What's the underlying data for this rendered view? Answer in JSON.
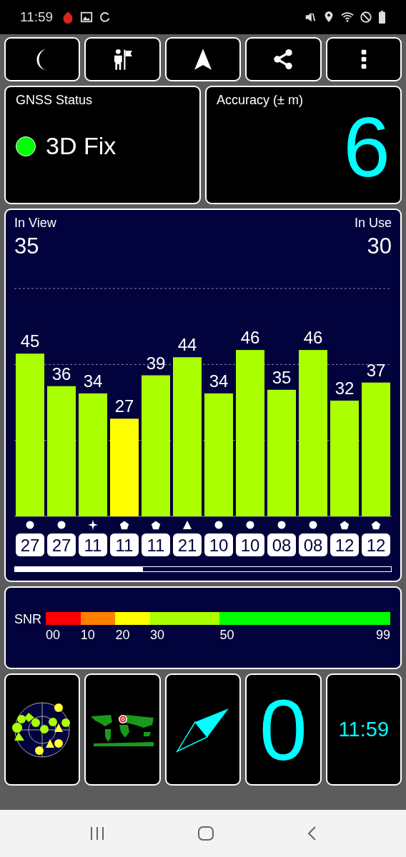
{
  "status_bar": {
    "time": "11:59",
    "left_icons": [
      {
        "kind": "app"
      },
      {
        "kind": "image"
      },
      {
        "kind": "sync"
      }
    ],
    "right_icons": [
      {
        "kind": "mute"
      },
      {
        "kind": "location"
      },
      {
        "kind": "wifi"
      },
      {
        "kind": "block"
      },
      {
        "kind": "battery"
      }
    ]
  },
  "toolbar": [
    {
      "kind": "moon"
    },
    {
      "kind": "person-flag"
    },
    {
      "kind": "navigation"
    },
    {
      "kind": "share"
    },
    {
      "kind": "more"
    }
  ],
  "gnss_status": {
    "title": "GNSS Status",
    "value": "3D Fix",
    "color": "#00ff00"
  },
  "accuracy": {
    "title": "Accuracy (± m)",
    "value": "6"
  },
  "satellites": {
    "in_view_label": "In View",
    "in_view": "35",
    "in_use_label": "In Use",
    "in_use": "30",
    "chart_data": {
      "type": "bar",
      "categories": [
        "27",
        "27",
        "11",
        "11",
        "11",
        "21",
        "10",
        "10",
        "08",
        "08",
        "12",
        "12"
      ],
      "series": [
        {
          "values": [
            45,
            36,
            34,
            27,
            39,
            44,
            34,
            46,
            35,
            46,
            32,
            37
          ]
        }
      ],
      "data_labels": true
    },
    "constellations": [
      {
        "kind": "circle"
      },
      {
        "kind": "circle"
      },
      {
        "kind": "star"
      },
      {
        "kind": "pentagon"
      },
      {
        "kind": "pentagon"
      },
      {
        "kind": "triangle"
      },
      {
        "kind": "circle"
      },
      {
        "kind": "circle"
      },
      {
        "kind": "circle"
      },
      {
        "kind": "circle"
      },
      {
        "kind": "pentagon"
      },
      {
        "kind": "pentagon"
      }
    ]
  },
  "snr_scale": {
    "label": "SNR",
    "stops": [
      {
        "label": "00",
        "color": "#ff0000"
      },
      {
        "label": "10",
        "color": "#ff8000"
      },
      {
        "label": "20",
        "color": "#ffff00"
      },
      {
        "label": "30",
        "color": "#aaff00"
      },
      {
        "label": "50",
        "color": "#00ff00"
      },
      {
        "label": "99"
      }
    ]
  },
  "tiles": [
    {
      "kind": "skyplot"
    },
    {
      "kind": "worldmap"
    },
    {
      "kind": "compass"
    },
    {
      "kind": "speed",
      "value": "0"
    },
    {
      "kind": "clock",
      "value": "11:59"
    }
  ],
  "nav_bar": [
    {
      "kind": "recents"
    },
    {
      "kind": "home"
    },
    {
      "kind": "back"
    }
  ]
}
